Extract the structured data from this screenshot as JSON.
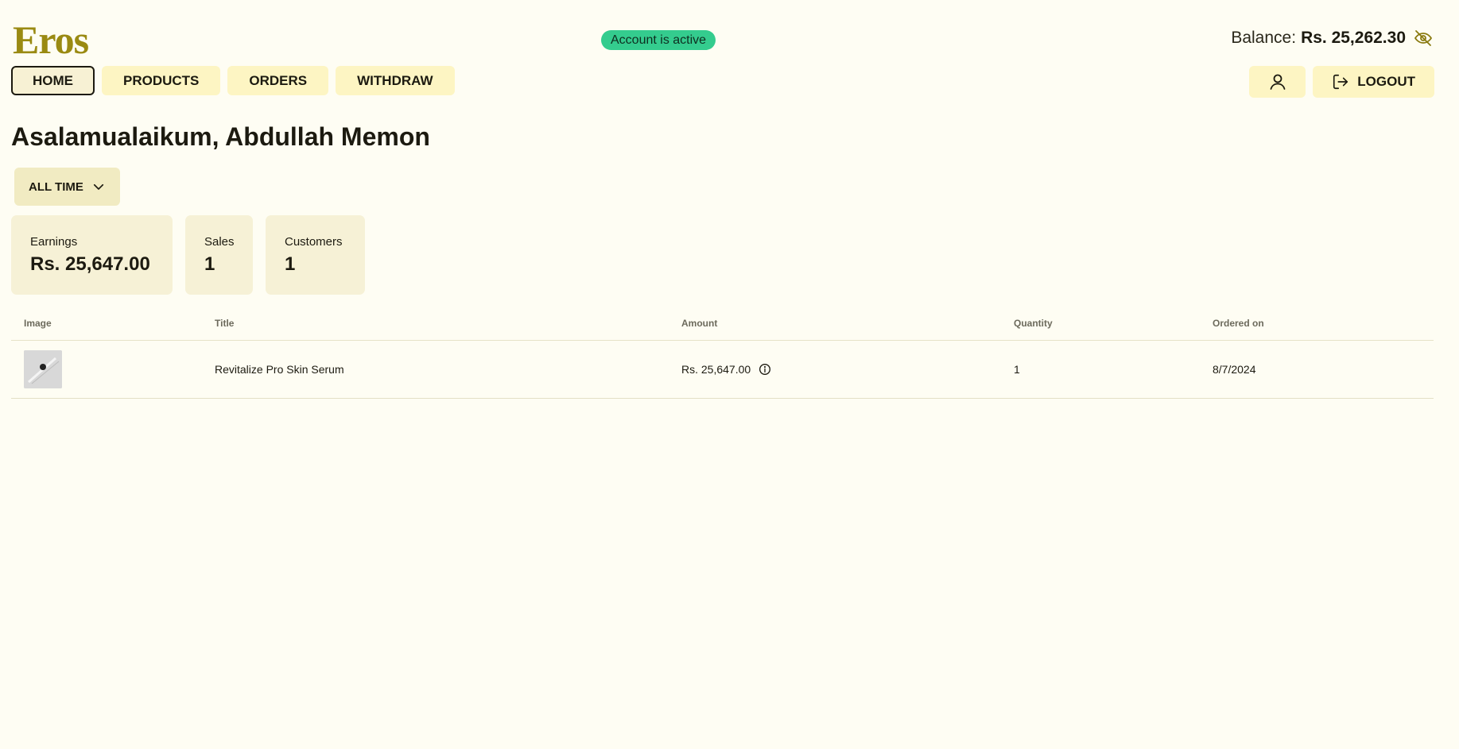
{
  "brand": {
    "logo_text": "Eros",
    "color": "#9a8a12"
  },
  "header": {
    "status_badge": "Account is active",
    "balance_label": "Balance:",
    "balance_value": "Rs. 25,262.30",
    "balance_toggle_icon": "eye-off-icon"
  },
  "nav": {
    "items": [
      {
        "label": "HOME",
        "active": true
      },
      {
        "label": "PRODUCTS",
        "active": false
      },
      {
        "label": "ORDERS",
        "active": false
      },
      {
        "label": "WITHDRAW",
        "active": false
      }
    ],
    "profile_icon": "user-icon",
    "logout_label": "LOGOUT",
    "logout_icon": "logout-icon"
  },
  "greeting": "Asalamualaikum, Abdullah Memon",
  "filter": {
    "selected": "ALL TIME",
    "icon": "chevron-down-icon"
  },
  "stats": [
    {
      "label": "Earnings",
      "value": "Rs. 25,647.00"
    },
    {
      "label": "Sales",
      "value": "1"
    },
    {
      "label": "Customers",
      "value": "1"
    }
  ],
  "table": {
    "headers": [
      "Image",
      "Title",
      "Amount",
      "Quantity",
      "Ordered on"
    ],
    "rows": [
      {
        "title": "Revitalize Pro Skin Serum",
        "amount": "Rs. 25,647.00",
        "quantity": "1",
        "ordered_on": "8/7/2024"
      }
    ]
  },
  "colors": {
    "background": "#fefdf3",
    "nav_button": "#fdf5c3",
    "status_green": "#34cc8e",
    "card": "#f6f1d6"
  }
}
